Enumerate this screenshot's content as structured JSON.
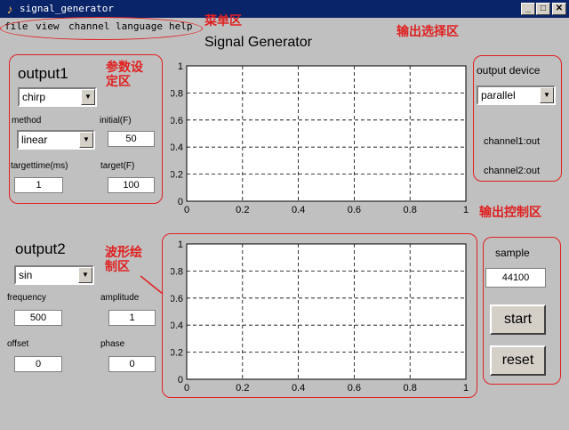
{
  "window": {
    "title": "signal_generator",
    "minimize": "_",
    "maximize": "□",
    "close": "✕"
  },
  "menu": [
    "file",
    "view",
    "channel",
    "language",
    "help"
  ],
  "annotations": {
    "menu_area": "菜单区",
    "params_area": "参数设\n定区",
    "output_select": "输出选择区",
    "plot_area": "波形绘\n制区",
    "output_control": "输出控制区"
  },
  "signal_title": "Signal Generator",
  "output1": {
    "heading": "output1",
    "waveform": "chirp",
    "method_label": "method",
    "method": "linear",
    "initial_label": "initial(F)",
    "initial": "50",
    "targettime_label": "targettime(ms)",
    "targettime": "1",
    "target_label": "target(F)",
    "target": "100"
  },
  "output2": {
    "heading": "output2",
    "waveform": "sin",
    "frequency_label": "frequency",
    "frequency": "500",
    "amplitude_label": "amplitude",
    "amplitude": "1",
    "offset_label": "offset",
    "offset": "0",
    "phase_label": "phase",
    "phase": "0"
  },
  "output_device": {
    "label": "output device",
    "selected": "parallel",
    "channel1": "channel1:out",
    "channel2": "channel2:out"
  },
  "control": {
    "sample_label": "sample",
    "sample": "44100",
    "start": "start",
    "reset": "reset"
  },
  "chart_data": [
    {
      "type": "line",
      "x_ticks": [
        "0",
        "0.2",
        "0.4",
        "0.6",
        "0.8",
        "1"
      ],
      "y_ticks": [
        "0",
        "0.2",
        "0.4",
        "0.6",
        "0.8",
        "1"
      ],
      "xlim": [
        0,
        1
      ],
      "ylim": [
        0,
        1
      ],
      "grid": true,
      "series": []
    },
    {
      "type": "line",
      "x_ticks": [
        "0",
        "0.2",
        "0.4",
        "0.6",
        "0.8",
        "1"
      ],
      "y_ticks": [
        "0",
        "0.2",
        "0.4",
        "0.6",
        "0.8",
        "1"
      ],
      "xlim": [
        0,
        1
      ],
      "ylim": [
        0,
        1
      ],
      "grid": true,
      "series": []
    }
  ],
  "colors": {
    "annotation": "#e02020",
    "titlebar": "#0a246a",
    "background": "#c0c0c0"
  }
}
